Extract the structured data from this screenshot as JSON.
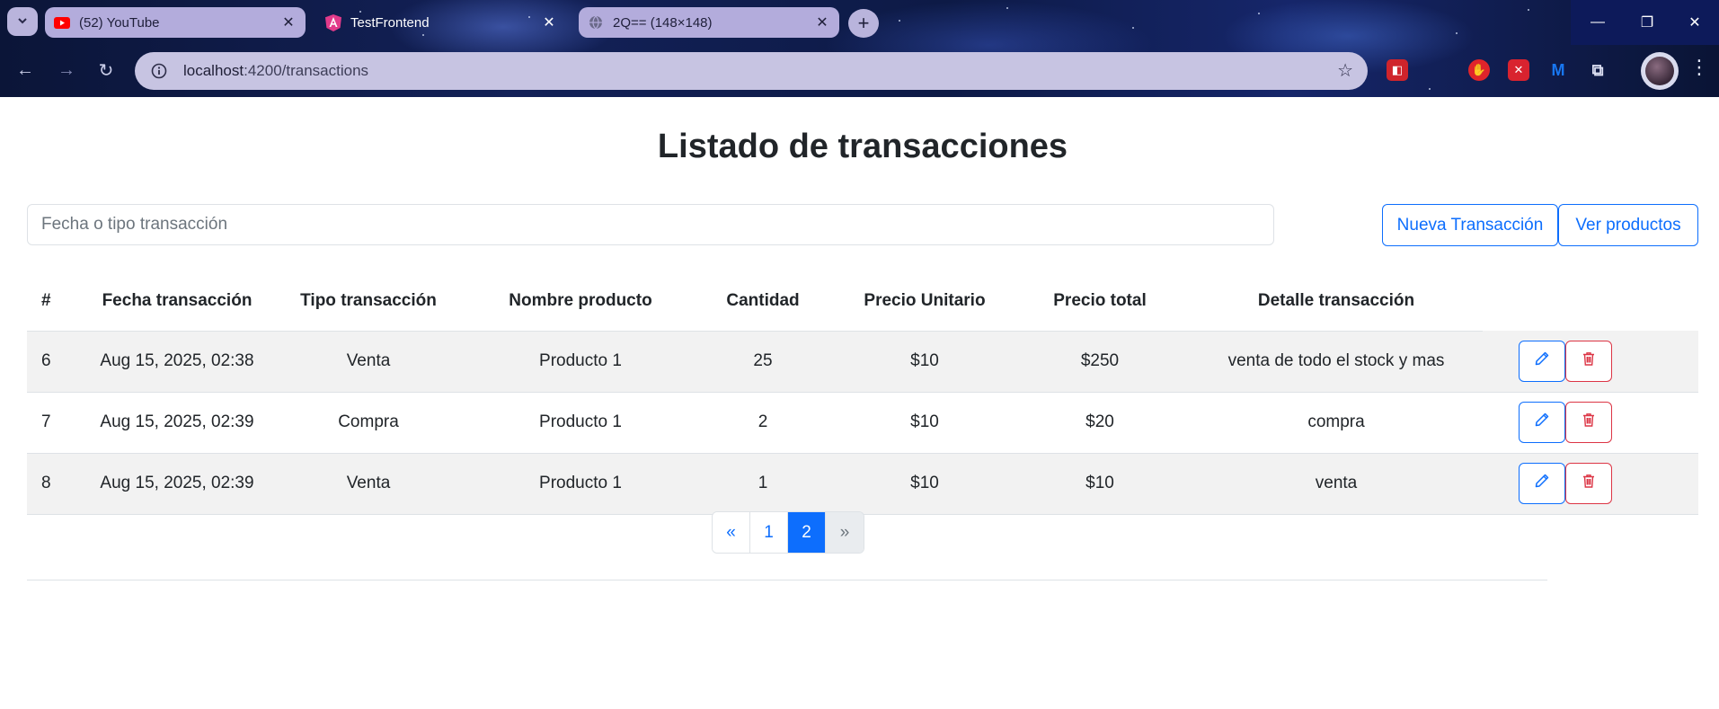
{
  "browser": {
    "tabs": [
      {
        "title": "(52) YouTube",
        "favicon": "youtube-icon",
        "state": "inactive"
      },
      {
        "title": "TestFrontend",
        "favicon": "angular-icon",
        "state": "active"
      },
      {
        "title": "2Q== (148×148)",
        "favicon": "globe-icon",
        "state": "inactive"
      }
    ],
    "url_host": "localhost",
    "url_path": ":4200/transactions",
    "icons": {
      "tab_search": "chevron-down-icon",
      "new_tab": "plus-icon",
      "back": "arrow-left-icon",
      "forward": "arrow-right-icon",
      "reload": "reload-icon",
      "site_info": "site-info-icon",
      "bookmark": "star-icon",
      "extensions": "puzzle-icon",
      "menu": "kebab-menu-icon"
    }
  },
  "page": {
    "title": "Listado de transacciones",
    "search_placeholder": "Fecha o tipo transacción",
    "new_transaction_label": "Nueva Transacción",
    "view_products_label": "Ver productos"
  },
  "table": {
    "headers": [
      "#",
      "Fecha transacción",
      "Tipo transacción",
      "Nombre producto",
      "Cantidad",
      "Precio Unitario",
      "Precio total",
      "Detalle transacción",
      ""
    ],
    "rows": [
      {
        "id": "6",
        "date": "Aug 15, 2025, 02:38",
        "type": "Venta",
        "product": "Producto 1",
        "qty": "25",
        "unit_price": "$10",
        "total": "$250",
        "detail": "venta de todo el stock y mas"
      },
      {
        "id": "7",
        "date": "Aug 15, 2025, 02:39",
        "type": "Compra",
        "product": "Producto 1",
        "qty": "2",
        "unit_price": "$10",
        "total": "$20",
        "detail": "compra"
      },
      {
        "id": "8",
        "date": "Aug 15, 2025, 02:39",
        "type": "Venta",
        "product": "Producto 1",
        "qty": "1",
        "unit_price": "$10",
        "total": "$10",
        "detail": "venta"
      }
    ]
  },
  "pagination": {
    "prev": "«",
    "pages": [
      "1",
      "2"
    ],
    "active_page": "2",
    "next": "»"
  },
  "colors": {
    "primary": "#0d6efd",
    "danger": "#dc3545",
    "stripe": "#f2f2f2",
    "text": "#212529"
  }
}
